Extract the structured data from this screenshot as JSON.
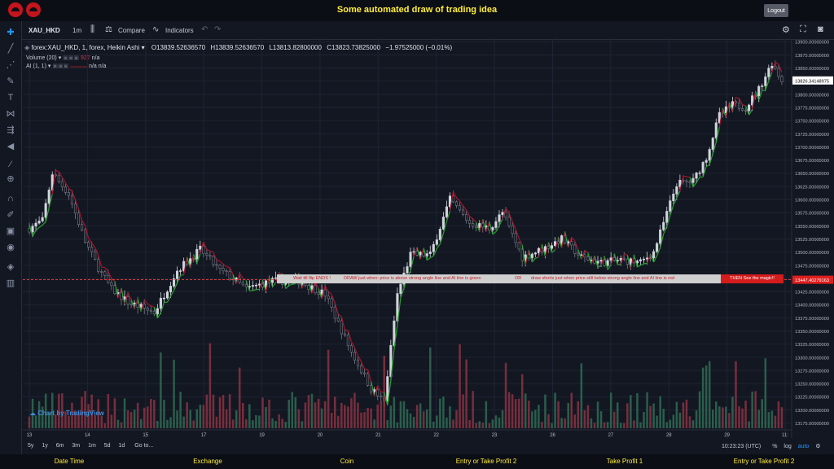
{
  "page": {
    "title": "Some automated draw of trading idea",
    "logout_label": "Logout"
  },
  "header": {
    "symbol": "XAU_HKD",
    "interval": "1m",
    "compare_label": "Compare",
    "indicators_label": "Indicators"
  },
  "legend": {
    "title": "forex:XAU_HKD, 1, forex, Heikin Ashi",
    "open": "O13839.52636570",
    "high": "H13839.52636570",
    "low": "L13813.82800000",
    "close": "C13823.73825000",
    "change": "−1.97525000 (−0.01%)",
    "volume_label": "Volume (20)",
    "volume_value": "927",
    "volume_ma": "n/a",
    "ai_label": "AI (1, 1)",
    "ai_v1": "n/a",
    "ai_v2": "n/a"
  },
  "overlay": {
    "prefix": "Wait till flip ENDS !",
    "part1": "DRAW just when:  price is above strong angle line and AI line is green",
    "or": "OR",
    "part2": "draw shorts just when price still below strong angle line and AI line is red",
    "cta": "THEN See the magic!!"
  },
  "price_axis": {
    "ticks": [
      "13900.00000000",
      "13875.00000000",
      "13850.00000000",
      "13825.00000000",
      "13800.00000000",
      "13775.00000000",
      "13750.00000000",
      "13725.00000000",
      "13700.00000000",
      "13675.00000000",
      "13650.00000000",
      "13625.00000000",
      "13600.00000000",
      "13575.00000000",
      "13550.00000000",
      "13525.00000000",
      "13500.00000000",
      "13475.00000000",
      "13450.00000000",
      "13425.00000000",
      "13400.00000000",
      "13375.00000000",
      "13350.00000000",
      "13325.00000000",
      "13300.00000000",
      "13275.00000000",
      "13250.00000000",
      "13225.00000000",
      "13200.00000000",
      "13175.00000000"
    ],
    "current_price": "13826.34148975",
    "line_price": "13447.40279163"
  },
  "time_axis": {
    "labels": [
      "13",
      "14",
      "15",
      "17",
      "19",
      "20",
      "21",
      "22",
      "23",
      "26",
      "27",
      "28",
      "29",
      "11:"
    ]
  },
  "footer": {
    "ranges": [
      "5y",
      "1y",
      "6m",
      "3m",
      "1m",
      "5d",
      "1d"
    ],
    "goto_label": "Go to...",
    "clock": "10:23:23 (UTC)",
    "percent_label": "%",
    "log_label": "log",
    "auto_label": "auto"
  },
  "watermark": "Chart by TradingView",
  "bottom_labels": [
    "Date Time",
    "Exchange",
    "Coin",
    "Entry or Take Profit 2",
    "Take Profit 1",
    "Entry or Take Profit 2"
  ],
  "chart_data": {
    "type": "candlestick",
    "ylim": [
      13165,
      13905
    ],
    "price_keypoints": [
      [
        0,
        13545
      ],
      [
        4,
        13560
      ],
      [
        7,
        13650
      ],
      [
        12,
        13610
      ],
      [
        17,
        13520
      ],
      [
        21,
        13470
      ],
      [
        25,
        13430
      ],
      [
        30,
        13405
      ],
      [
        38,
        13385
      ],
      [
        45,
        13465
      ],
      [
        52,
        13505
      ],
      [
        58,
        13465
      ],
      [
        62,
        13450
      ],
      [
        66,
        13430
      ],
      [
        74,
        13445
      ],
      [
        82,
        13445
      ],
      [
        90,
        13420
      ],
      [
        98,
        13310
      ],
      [
        104,
        13240
      ],
      [
        108,
        13215
      ],
      [
        112,
        13420
      ],
      [
        116,
        13495
      ],
      [
        122,
        13495
      ],
      [
        128,
        13600
      ],
      [
        134,
        13555
      ],
      [
        140,
        13545
      ],
      [
        144,
        13575
      ],
      [
        150,
        13490
      ],
      [
        156,
        13505
      ],
      [
        162,
        13525
      ],
      [
        168,
        13490
      ],
      [
        174,
        13480
      ],
      [
        180,
        13485
      ],
      [
        186,
        13480
      ],
      [
        190,
        13500
      ],
      [
        193,
        13555
      ],
      [
        197,
        13630
      ],
      [
        202,
        13635
      ],
      [
        206,
        13680
      ],
      [
        210,
        13760
      ],
      [
        214,
        13780
      ],
      [
        218,
        13775
      ],
      [
        222,
        13810
      ],
      [
        226,
        13860
      ],
      [
        229,
        13826
      ]
    ],
    "colors": {
      "up": "#d1d4dc",
      "down": "#787b86",
      "ai_green": "#26a12e",
      "ai_red": "#a3162a",
      "vol_up": "#2f6b52",
      "vol_down": "#8a3342",
      "angle_line": "#ff4040",
      "price_label": "#e01e1e"
    }
  }
}
